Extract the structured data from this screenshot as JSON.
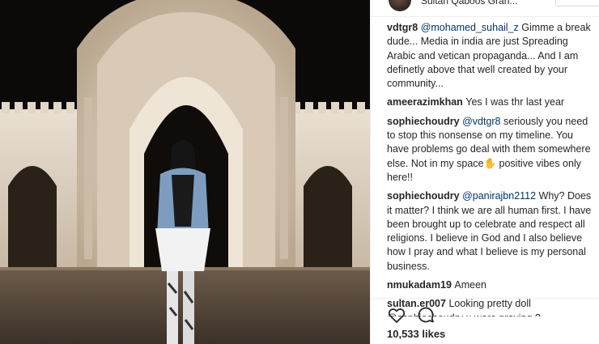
{
  "header": {
    "location": "Sultan Qaboos Gran..."
  },
  "comments": [
    {
      "user": "vdtgr8",
      "mention": "@mohamed_suhail_z",
      "text": " Gimme a break dude... Media in india are just Spreading Arabic and vetican propaganda... And I am definetly above that well created by your community..."
    },
    {
      "user": "ameerazimkhan",
      "mention": "",
      "text": "Yes I was thr last year"
    },
    {
      "user": "sophiechoudry",
      "mention": "@vdtgr8",
      "text": " seriously you need to stop this nonsense on my timeline. You have problems go deal with them somewhere else. Not in my space✋ positive vibes only here!!"
    },
    {
      "user": "sophiechoudry",
      "mention": "@panirajbn2112",
      "text": " Why? Does it matter? I think we are all human first. I have been brought up to celebrate and respect all religions. I believe in God and I also believe how I pray and what I believe is my personal business."
    },
    {
      "user": "nmukadam19",
      "mention": "",
      "text": "Ameen"
    },
    {
      "user": "sultan.er007",
      "mention": "",
      "text": "Looking pretty doll @sophiechoudry u were praying ?"
    }
  ],
  "actions": {
    "likes": "10,533 likes",
    "like_icon": "heart-icon",
    "comment_icon": "comment-icon"
  },
  "colors": {
    "text": "#262626",
    "mention": "#003569",
    "border": "#efefef"
  }
}
